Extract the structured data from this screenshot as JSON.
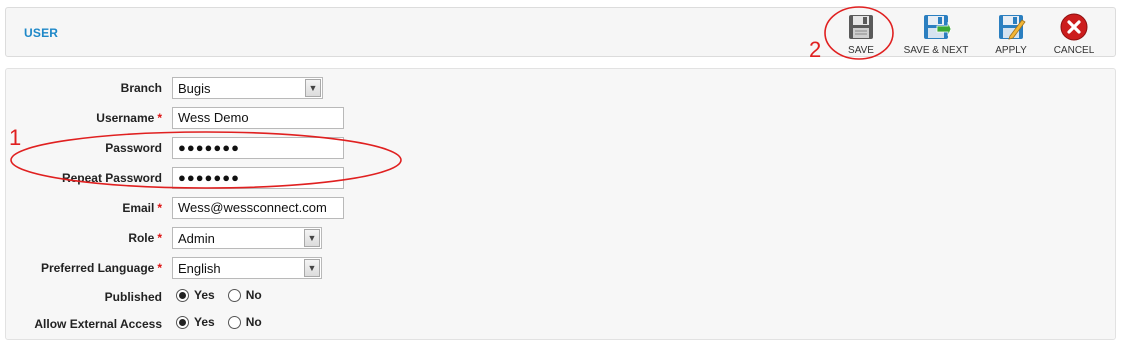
{
  "header": {
    "title": "USER",
    "buttons": [
      {
        "label": "SAVE",
        "icon": "floppy-disk-icon"
      },
      {
        "label": "SAVE & NEXT",
        "icon": "floppy-disk-next-icon"
      },
      {
        "label": "APPLY",
        "icon": "floppy-disk-edit-icon"
      },
      {
        "label": "CANCEL",
        "icon": "cancel-circle-icon"
      }
    ]
  },
  "form": {
    "branch": {
      "label": "Branch",
      "value": "Bugis"
    },
    "username": {
      "label": "Username",
      "value": "Wess Demo",
      "required": "*"
    },
    "password": {
      "label": "Password",
      "value": "●●●●●●●"
    },
    "repeat_password": {
      "label": "Repeat Password",
      "value": "●●●●●●●"
    },
    "email": {
      "label": "Email",
      "value": "Wess@wessconnect.com",
      "required": "*"
    },
    "role": {
      "label": "Role",
      "value": "Admin",
      "required": "*"
    },
    "language": {
      "label": "Preferred Language",
      "value": "English",
      "required": "*"
    },
    "published": {
      "label": "Published",
      "yes": "Yes",
      "no": "No",
      "selected": "Yes"
    },
    "external_access": {
      "label": "Allow External Access",
      "yes": "Yes",
      "no": "No",
      "selected": "Yes"
    }
  },
  "annotations": {
    "one": "1",
    "two": "2",
    "color": "#e02020"
  },
  "colors": {
    "title": "#1e88c8",
    "required": "#dd1111"
  }
}
